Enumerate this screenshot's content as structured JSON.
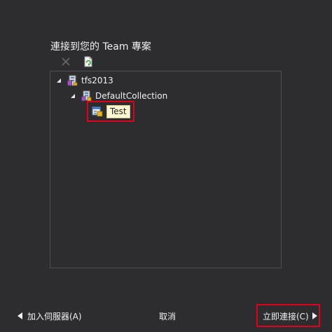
{
  "panel": {
    "title": "連接到您的 Team 專案"
  },
  "toolbar": {
    "items": [
      {
        "icon": "close-icon",
        "enabled": false
      },
      {
        "icon": "refresh-icon",
        "enabled": true
      }
    ]
  },
  "tree": {
    "server": {
      "label": "tfs2013",
      "icon": "server-icon",
      "expanded": true
    },
    "collection": {
      "label": "DefaultCollection",
      "icon": "collection-icon",
      "expanded": true
    },
    "project": {
      "label": "Test",
      "icon": "team-project-icon",
      "selected": true
    }
  },
  "footer": {
    "add_server_label": "加入伺服器(A)",
    "cancel_label": "取消",
    "connect_label": "立即連接(C)"
  },
  "colors": {
    "background": "#2d2d30",
    "border": "#505054",
    "text": "#f1f1f1",
    "highlight_box": "#e0001b",
    "selection_tooltip_bg": "#fff8d0"
  }
}
